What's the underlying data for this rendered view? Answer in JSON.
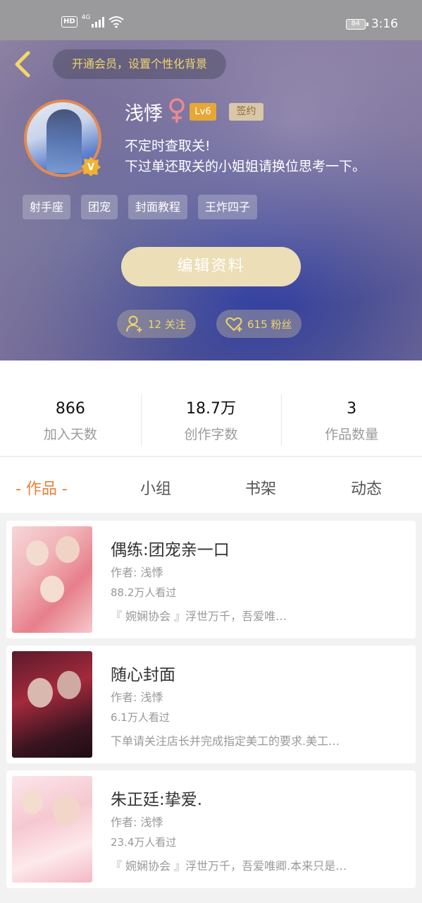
{
  "status_bar": {
    "hd": "HD",
    "network": "4G",
    "battery": "84",
    "time": "3:16"
  },
  "header": {
    "vip_banner": "开通会员，设置个性化背景"
  },
  "profile": {
    "name": "浅悸",
    "gender_symbol": "♀",
    "level": "Lv6",
    "sign_badge": "签约",
    "verified_badge": "V",
    "bio_lines": [
      "不定时查取关!",
      "下过单还取关的小姐姐请换位思考一下。"
    ],
    "tags": [
      "射手座",
      "团宠",
      "封面教程",
      "王炸四子"
    ],
    "edit_button": "编辑资料",
    "following": "12 关注",
    "followers": "615 粉丝"
  },
  "stats": [
    {
      "value": "866",
      "label": "加入天数"
    },
    {
      "value": "18.7万",
      "label": "创作字数"
    },
    {
      "value": "3",
      "label": "作品数量"
    }
  ],
  "tabs": [
    "- 作品 -",
    "小组",
    "书架",
    "动态"
  ],
  "works": [
    {
      "title": "偶练:团宠亲一口",
      "author": "作者: 浅悸",
      "views": "88.2万人看过",
      "desc": "『 婉娴协会 』浮世万千，吾爱唯…"
    },
    {
      "title": "随心封面",
      "author": "作者: 浅悸",
      "views": "6.1万人看过",
      "desc": "下单请关注店长并完成指定美工的要求.美工…"
    },
    {
      "title": "朱正廷:挚爱.",
      "author": "作者: 浅悸",
      "views": "23.4万人看过",
      "desc": "『 婉娴协会 』浮世万千，吾爱唯卿.本来只是…"
    }
  ],
  "colors": {
    "accent_orange": "#ea7f3a",
    "gold_text": "#f1d86a",
    "edit_button_bg": "#ecdeb6",
    "level_badge": "#e7a737"
  }
}
